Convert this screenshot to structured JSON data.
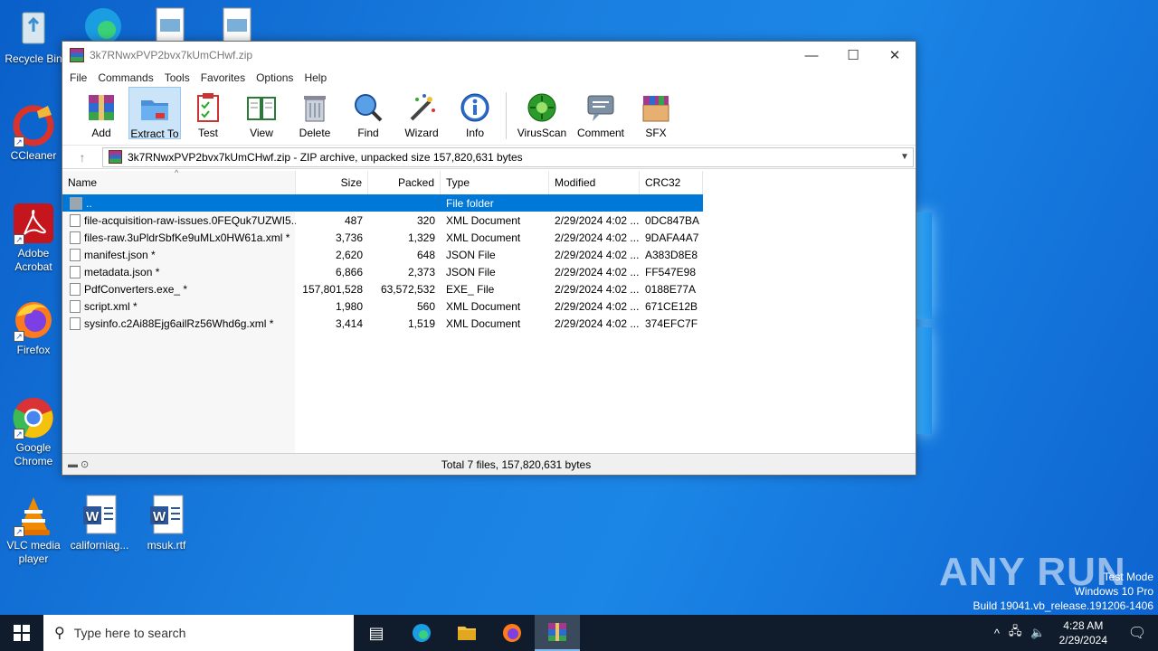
{
  "desktop": {
    "icons": [
      {
        "id": "recycle",
        "label": "Recycle Bin"
      },
      {
        "id": "ccleaner",
        "label": "CCleaner"
      },
      {
        "id": "acrobat",
        "label": "Adobe Acrobat"
      },
      {
        "id": "firefox",
        "label": "Firefox"
      },
      {
        "id": "chrome",
        "label": "Google Chrome"
      },
      {
        "id": "vlc",
        "label": "VLC media player"
      },
      {
        "id": "californiag",
        "label": "californiag..."
      },
      {
        "id": "msuk",
        "label": "msuk.rtf"
      }
    ]
  },
  "window": {
    "title": "3k7RNwxPVP2bvx7kUmCHwf.zip",
    "controls": {
      "minimize": "—",
      "maximize": "☐",
      "close": "✕"
    },
    "menu": [
      "File",
      "Commands",
      "Tools",
      "Favorites",
      "Options",
      "Help"
    ],
    "toolbar": [
      {
        "label": "Add",
        "icon": "add-icon"
      },
      {
        "label": "Extract To",
        "icon": "extract-icon"
      },
      {
        "label": "Test",
        "icon": "test-icon"
      },
      {
        "label": "View",
        "icon": "view-icon"
      },
      {
        "label": "Delete",
        "icon": "delete-icon"
      },
      {
        "label": "Find",
        "icon": "find-icon"
      },
      {
        "label": "Wizard",
        "icon": "wizard-icon"
      },
      {
        "label": "Info",
        "icon": "info-icon"
      },
      {
        "label": "VirusScan",
        "icon": "virusscan-icon"
      },
      {
        "label": "Comment",
        "icon": "comment-icon"
      },
      {
        "label": "SFX",
        "icon": "sfx-icon"
      }
    ],
    "address": "3k7RNwxPVP2bvx7kUmCHwf.zip - ZIP archive, unpacked size 157,820,631 bytes",
    "columns": {
      "name": "Name",
      "size": "Size",
      "packed": "Packed",
      "type": "Type",
      "modified": "Modified",
      "crc": "CRC32"
    },
    "rows": [
      {
        "name": "..",
        "size": "",
        "packed": "",
        "type": "File folder",
        "modified": "",
        "crc": ""
      },
      {
        "name": "file-acquisition-raw-issues.0FEQuk7UZWI5...",
        "size": "487",
        "packed": "320",
        "type": "XML Document",
        "modified": "2/29/2024 4:02 ...",
        "crc": "0DC847BA"
      },
      {
        "name": "files-raw.3uPldrSbfKe9uMLx0HW61a.xml *",
        "size": "3,736",
        "packed": "1,329",
        "type": "XML Document",
        "modified": "2/29/2024 4:02 ...",
        "crc": "9DAFA4A7"
      },
      {
        "name": "manifest.json *",
        "size": "2,620",
        "packed": "648",
        "type": "JSON File",
        "modified": "2/29/2024 4:02 ...",
        "crc": "A383D8E8"
      },
      {
        "name": "metadata.json *",
        "size": "6,866",
        "packed": "2,373",
        "type": "JSON File",
        "modified": "2/29/2024 4:02 ...",
        "crc": "FF547E98"
      },
      {
        "name": "PdfConverters.exe_ *",
        "size": "157,801,528",
        "packed": "63,572,532",
        "type": "EXE_ File",
        "modified": "2/29/2024 4:02 ...",
        "crc": "0188E77A"
      },
      {
        "name": "script.xml *",
        "size": "1,980",
        "packed": "560",
        "type": "XML Document",
        "modified": "2/29/2024 4:02 ...",
        "crc": "671CE12B"
      },
      {
        "name": "sysinfo.c2Ai88Ejg6ailRz56Whd6g.xml *",
        "size": "3,414",
        "packed": "1,519",
        "type": "XML Document",
        "modified": "2/29/2024 4:02 ...",
        "crc": "374EFC7F"
      }
    ],
    "status": "Total 7 files, 157,820,631 bytes"
  },
  "taskbar": {
    "search_placeholder": "Type here to search",
    "time": "4:28 AM",
    "date": "2/29/2024"
  },
  "watermark": {
    "brand": "ANY RUN",
    "line1": "Test Mode",
    "line2": "Windows 10 Pro",
    "line3": "Build 19041.vb_release.191206-1406"
  }
}
